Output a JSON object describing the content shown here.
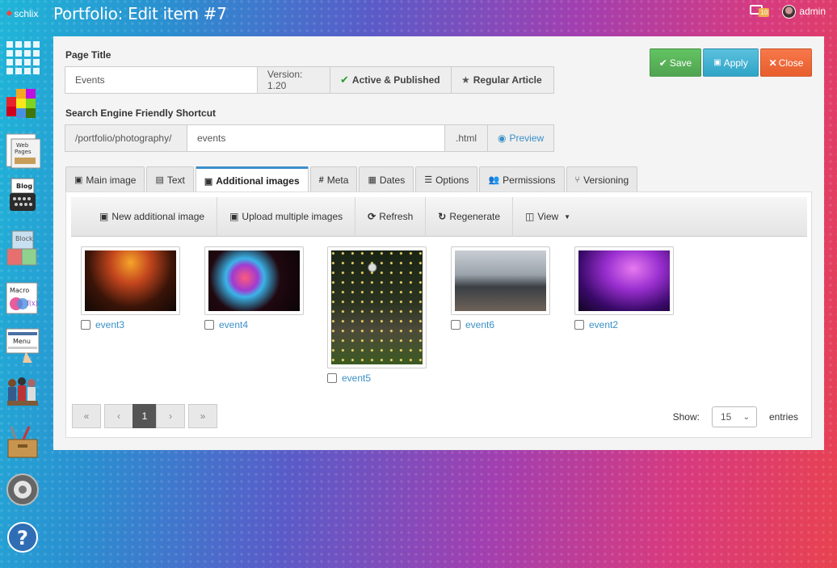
{
  "app": {
    "brand": "schlix",
    "page_heading": "Portfolio: Edit item #7",
    "notification_count": "10",
    "user_name": "admin"
  },
  "sidebar": {
    "items": [
      {
        "name": "apps-grid-icon"
      },
      {
        "name": "color-blocks-icon"
      },
      {
        "name": "web-pages-icon",
        "text": "Web Pages"
      },
      {
        "name": "blog-icon",
        "text": "Blog"
      },
      {
        "name": "block-icon",
        "text": "Block"
      },
      {
        "name": "macro-icon",
        "text": "Macro f(x)"
      },
      {
        "name": "menu-icon",
        "text": "Menu"
      },
      {
        "name": "users-icon"
      },
      {
        "name": "toolbox-icon"
      },
      {
        "name": "settings-icon"
      },
      {
        "name": "help-icon"
      }
    ]
  },
  "form": {
    "page_title_label": "Page Title",
    "page_title_value": "Events",
    "version": "Version: 1.20",
    "status": "Active & Published",
    "article_type": "Regular Article",
    "shortcut_label": "Search Engine Friendly Shortcut",
    "shortcut_prefix": "/portfolio/photography/",
    "shortcut_value": "events",
    "shortcut_suffix": ".html",
    "preview_label": "Preview"
  },
  "actions": {
    "save": "Save",
    "apply": "Apply",
    "close": "Close"
  },
  "tabs": [
    {
      "label": "Main image",
      "icon": "image-icon"
    },
    {
      "label": "Text",
      "icon": "document-icon"
    },
    {
      "label": "Additional images",
      "icon": "images-icon",
      "active": true
    },
    {
      "label": "Meta",
      "icon": "hash-icon"
    },
    {
      "label": "Dates",
      "icon": "calendar-icon"
    },
    {
      "label": "Options",
      "icon": "sliders-icon"
    },
    {
      "label": "Permissions",
      "icon": "users-icon"
    },
    {
      "label": "Versioning",
      "icon": "branch-icon"
    }
  ],
  "toolbar": {
    "new_image": "New additional image",
    "upload_multiple": "Upload multiple images",
    "refresh": "Refresh",
    "regenerate": "Regenerate",
    "view": "View"
  },
  "images": [
    {
      "caption": "event3"
    },
    {
      "caption": "event4"
    },
    {
      "caption": "event5"
    },
    {
      "caption": "event6"
    },
    {
      "caption": "event2"
    }
  ],
  "pagination": {
    "first": "«",
    "prev": "‹",
    "current": "1",
    "next": "›",
    "last": "»"
  },
  "entries": {
    "show_label": "Show:",
    "value": "15",
    "suffix": "entries"
  },
  "colors": {
    "accent": "#3a8fc8",
    "save": "#5cb85c",
    "apply": "#5bc0de",
    "close": "#f0673b"
  }
}
